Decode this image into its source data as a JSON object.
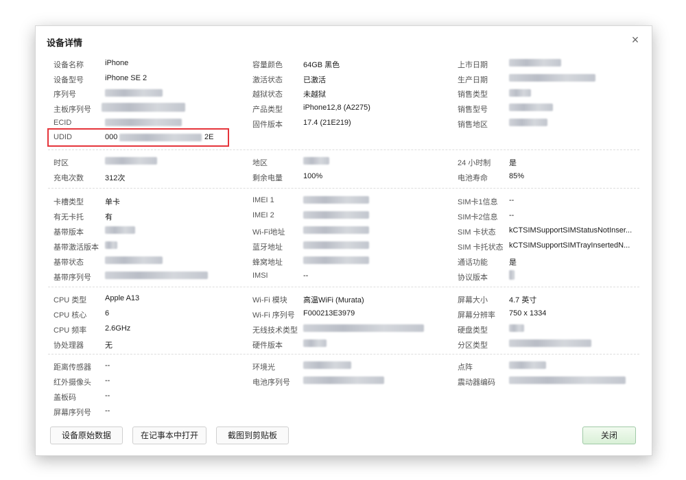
{
  "dialog": {
    "title": "设备详情",
    "close_glyph": "×"
  },
  "section1": {
    "col1": [
      {
        "label": "设备名称",
        "value": "iPhone"
      },
      {
        "label": "设备型号",
        "value": "iPhone SE 2"
      },
      {
        "label": "序列号",
        "value": ""
      },
      {
        "label": "主板序列号",
        "value": ""
      },
      {
        "label": "ECID",
        "value": ""
      },
      {
        "label": "UDID",
        "value_prefix": "000",
        "value_suffix": "2E"
      }
    ],
    "col2": [
      {
        "label": "容量颜色",
        "value": "64GB 黑色"
      },
      {
        "label": "激活状态",
        "value": "已激活"
      },
      {
        "label": "越狱状态",
        "value": "未越狱"
      },
      {
        "label": "产品类型",
        "value": "iPhone12,8 (A2275)"
      },
      {
        "label": "固件版本",
        "value": "17.4 (21E219)"
      }
    ],
    "col3": [
      {
        "label": "上市日期",
        "value": ""
      },
      {
        "label": "生产日期",
        "value": ""
      },
      {
        "label": "销售类型",
        "value": ""
      },
      {
        "label": "销售型号",
        "value": ""
      },
      {
        "label": "销售地区",
        "value": ""
      }
    ]
  },
  "section2": {
    "col1": [
      {
        "label": "时区",
        "value": ""
      },
      {
        "label": "充电次数",
        "value": "312次"
      }
    ],
    "col2": [
      {
        "label": "地区",
        "value": ""
      },
      {
        "label": "剩余电量",
        "value": "100%"
      }
    ],
    "col3": [
      {
        "label": "24 小时制",
        "value": "是"
      },
      {
        "label": "电池寿命",
        "value": "85%"
      }
    ]
  },
  "section3": {
    "col1": [
      {
        "label": "卡槽类型",
        "value": "单卡"
      },
      {
        "label": "有无卡托",
        "value": "有"
      },
      {
        "label": "基带版本",
        "value": ""
      },
      {
        "label": "基带激活版本",
        "value": ""
      },
      {
        "label": "基带状态",
        "value": ""
      },
      {
        "label": "基带序列号",
        "value": ""
      }
    ],
    "col2": [
      {
        "label": "IMEI 1",
        "value": ""
      },
      {
        "label": "IMEI 2",
        "value": ""
      },
      {
        "label": "Wi-Fi地址",
        "value": ""
      },
      {
        "label": "蓝牙地址",
        "value": ""
      },
      {
        "label": "蜂窝地址",
        "value": ""
      },
      {
        "label": "IMSI",
        "value": "--"
      }
    ],
    "col3": [
      {
        "label": "SIM卡1信息",
        "value": "--"
      },
      {
        "label": "SIM卡2信息",
        "value": "--"
      },
      {
        "label": "SIM 卡状态",
        "value": "kCTSIMSupportSIMStatusNotInser..."
      },
      {
        "label": "SIM 卡托状态",
        "value": "kCTSIMSupportSIMTrayInsertedN..."
      },
      {
        "label": "通话功能",
        "value": "是"
      },
      {
        "label": "协议版本",
        "value": ""
      }
    ]
  },
  "section4": {
    "col1": [
      {
        "label": "CPU 类型",
        "value": "Apple A13"
      },
      {
        "label": "CPU 核心",
        "value": "6"
      },
      {
        "label": "CPU 频率",
        "value": "2.6GHz"
      },
      {
        "label": "协处理器",
        "value": "无"
      }
    ],
    "col2": [
      {
        "label": "Wi-Fi 模块",
        "value": "高温WiFi (Murata)"
      },
      {
        "label": "Wi-Fi 序列号",
        "value": "F000213E3979"
      },
      {
        "label": "无线技术类型",
        "value": ""
      },
      {
        "label": "硬件版本",
        "value": ""
      }
    ],
    "col3": [
      {
        "label": "屏幕大小",
        "value": "4.7 英寸"
      },
      {
        "label": "屏幕分辨率",
        "value": "750 x 1334"
      },
      {
        "label": "硬盘类型",
        "value": ""
      },
      {
        "label": "分区类型",
        "value": ""
      }
    ]
  },
  "section5": {
    "col1": [
      {
        "label": "距离传感器",
        "value": "--"
      },
      {
        "label": "红外摄像头",
        "value": "--"
      },
      {
        "label": "盖板码",
        "value": "--"
      },
      {
        "label": "屏幕序列号",
        "value": "--"
      }
    ],
    "col2": [
      {
        "label": "环境光",
        "value": ""
      },
      {
        "label": "电池序列号",
        "value": ""
      }
    ],
    "col3": [
      {
        "label": "点阵",
        "value": ""
      },
      {
        "label": "震动器编码",
        "value": ""
      }
    ]
  },
  "buttons": {
    "raw_data": "设备原始数据",
    "open_notepad": "在记事本中打开",
    "screenshot_clipboard": "截图到剪贴板",
    "close": "关闭"
  },
  "colors": {
    "highlight_box": "#e5343a",
    "close_button_bg": "#d9f0d7"
  }
}
